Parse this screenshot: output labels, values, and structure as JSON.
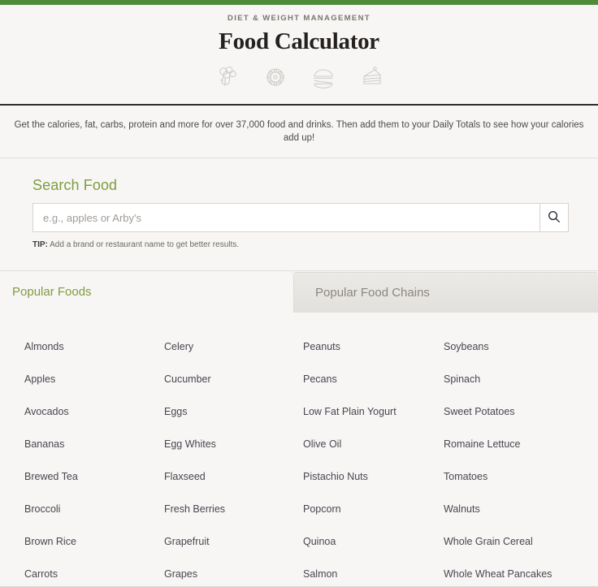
{
  "theme": {
    "top_bar_color": "#4e8c39",
    "accent_green": "#7f9c40",
    "page_background": "#f7f6f4",
    "text_color": "#4a4550"
  },
  "header": {
    "eyebrow": "DIET & WEIGHT MANAGEMENT",
    "title": "Food Calculator",
    "icons": [
      "broccoli-icon",
      "pizza-icon",
      "burger-icon",
      "cake-slice-icon"
    ]
  },
  "description": {
    "text": "Get the calories, fat, carbs, protein and more for over 37,000 food and drinks. Then add them to your Daily Totals to see how your calories add up!"
  },
  "search": {
    "heading": "Search Food",
    "placeholder": "e.g., apples or Arby's",
    "value": "",
    "button_icon": "search-icon",
    "tip_label": "TIP:",
    "tip_text": " Add a brand or restaurant name to get better results."
  },
  "tabs": [
    {
      "label": "Popular Foods",
      "active": true
    },
    {
      "label": "Popular Food Chains",
      "active": false
    }
  ],
  "popular_foods": {
    "columns": [
      [
        "Almonds",
        "Apples",
        "Avocados",
        "Bananas",
        "Brewed Tea",
        "Broccoli",
        "Brown Rice",
        "Carrots"
      ],
      [
        "Celery",
        "Cucumber",
        "Eggs",
        "Egg Whites",
        "Flaxseed",
        "Fresh Berries",
        "Grapefruit",
        "Grapes"
      ],
      [
        "Peanuts",
        "Pecans",
        "Low Fat Plain Yogurt",
        "Olive Oil",
        "Pistachio Nuts",
        "Popcorn",
        "Quinoa",
        "Salmon"
      ],
      [
        "Soybeans",
        "Spinach",
        "Sweet Potatoes",
        "Romaine Lettuce",
        "Tomatoes",
        "Walnuts",
        "Whole Grain Cereal",
        "Whole Wheat Pancakes"
      ]
    ]
  }
}
